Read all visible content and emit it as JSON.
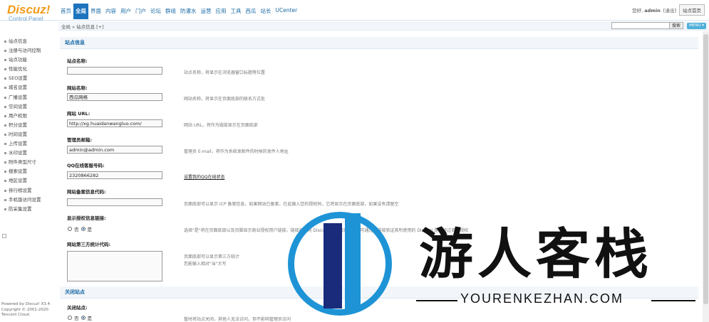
{
  "logo": {
    "title": "Discuz!",
    "subtitle": "Control Panel"
  },
  "nav": [
    "首页",
    "全局",
    "界面",
    "内容",
    "用户",
    "门户",
    "论坛",
    "群组",
    "防灌水",
    "运营",
    "应用",
    "工具",
    "西瓜",
    "站长",
    "UCenter"
  ],
  "nav_active": 1,
  "user": {
    "greeting": "您好,",
    "name": "admin",
    "logout": "[退出]",
    "home_button": "站点首页"
  },
  "breadcrumb": "全局 » 站点信息  [+]",
  "search": {
    "value": "",
    "button": "搜索",
    "more": "MENU ▾"
  },
  "sidebar": [
    "站点信息",
    "注册与访问控制",
    "站点功能",
    "性能优化",
    "SEO设置",
    "域名设置",
    "广播设置",
    "空间设置",
    "用户权限",
    "积分设置",
    "时间设置",
    "上传设置",
    "水印设置",
    "附件类型尺寸",
    "搜索设置",
    "地区设置",
    "排行榜设置",
    "手机版访问设置",
    "防采集设置"
  ],
  "footer": [
    "Powered by Discuz! X3.4",
    "Copyright © 2001-2020",
    "Tencent Cloud."
  ],
  "section1": {
    "title": "站点信息"
  },
  "fields": {
    "site_name": {
      "label": "站点名称:",
      "value": "",
      "tip": "站点名称，将显示在浏览器窗口标题等位置"
    },
    "web_name": {
      "label": "网站名称:",
      "value": "西瓜网络",
      "tip": "网站名称，将显示在页面底部的联系方式处"
    },
    "web_url": {
      "label": "网站 URL:",
      "value": "http://xg.huaidanwangluo.com/",
      "tip": "网站 URL，将作为链接显示在页面底部"
    },
    "admin_email": {
      "label": "管理员邮箱:",
      "value": "admin@admin.com",
      "tip": "管理员 E-mail，将作为系统发邮件的时候的发件人地址"
    },
    "qq": {
      "label": "QQ在线客服号码:",
      "value": "2320866282",
      "tip": "设置我的QQ在线状态"
    },
    "icp": {
      "label": "网站备案信息代码:",
      "value": "",
      "tip": "页面底部可以显示 ICP 备案信息，如果网站已备案，在此输入您的授权码，它将显示在页面底部，如果没有请留空"
    },
    "show_icp": {
      "label": "显示授权信息链接:",
      "opt_no": "否",
      "opt_yes": "是",
      "tip": "选择\"是\"将在页面底部以及页脚显示商业授权用户链接，链接将指向 Discuz! 官方网站，用户可通过此链接验证其所使用的 Discuz! 是否经过商业授权"
    },
    "stats": {
      "label": "网站第三方统计代码:",
      "tip1": "页面底部可以显示第三方统计",
      "tip2": "您能输入相对\"当\"大写"
    }
  },
  "section2": {
    "title": "关闭站点"
  },
  "close_site": {
    "label": "关闭站点:",
    "opt_no": "否",
    "opt_yes": "是",
    "tip": "暂时将站点关闭，其他人无法访问，但不影响管理员访问"
  },
  "watermark": {
    "big": "游人客栈",
    "small": "YOURENKEZHAN.COM"
  }
}
